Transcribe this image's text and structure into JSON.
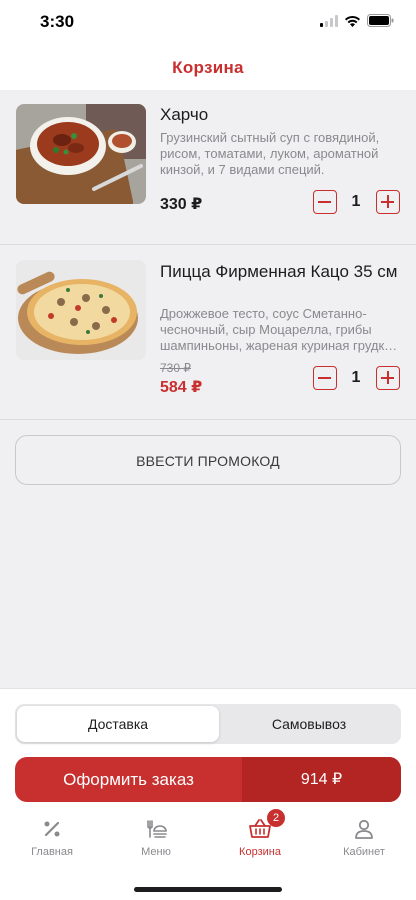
{
  "status": {
    "time": "3:30"
  },
  "header": {
    "title": "Корзина"
  },
  "items": [
    {
      "name": "Харчо",
      "description": "Грузинский сытный суп с говядиной, рисом, томатами, луком, ароматной кинзой, и 7 видами специй.",
      "price": "330 ₽",
      "quantity": "1"
    },
    {
      "name": "Пицца Фирменная Кацо 35 см",
      "description_lines": [
        "Дрожжевое тесто, соус Сметанно-",
        "чесночный, сыр Моцарелла, грибы",
        "шампиньоны, жареная куриная грудк…"
      ],
      "old_price": "730 ₽",
      "price": "584 ₽",
      "quantity": "1"
    }
  ],
  "promo": {
    "label": "ВВЕСТИ ПРОМОКОД"
  },
  "delivery_toggle": {
    "options": [
      "Доставка",
      "Самовывоз"
    ],
    "selected": "Доставка"
  },
  "checkout": {
    "label": "Оформить заказ",
    "total": "914 ₽"
  },
  "tabs": [
    {
      "label": "Главная",
      "icon": "percent-icon"
    },
    {
      "label": "Меню",
      "icon": "menu-food-icon"
    },
    {
      "label": "Корзина",
      "icon": "basket-icon",
      "badge": "2",
      "active": true
    },
    {
      "label": "Кабинет",
      "icon": "user-icon"
    }
  ],
  "colors": {
    "accent": "#c8302f",
    "accent_dark": "#b32523",
    "background": "#f0f0f2",
    "muted": "#8a8a8e"
  }
}
